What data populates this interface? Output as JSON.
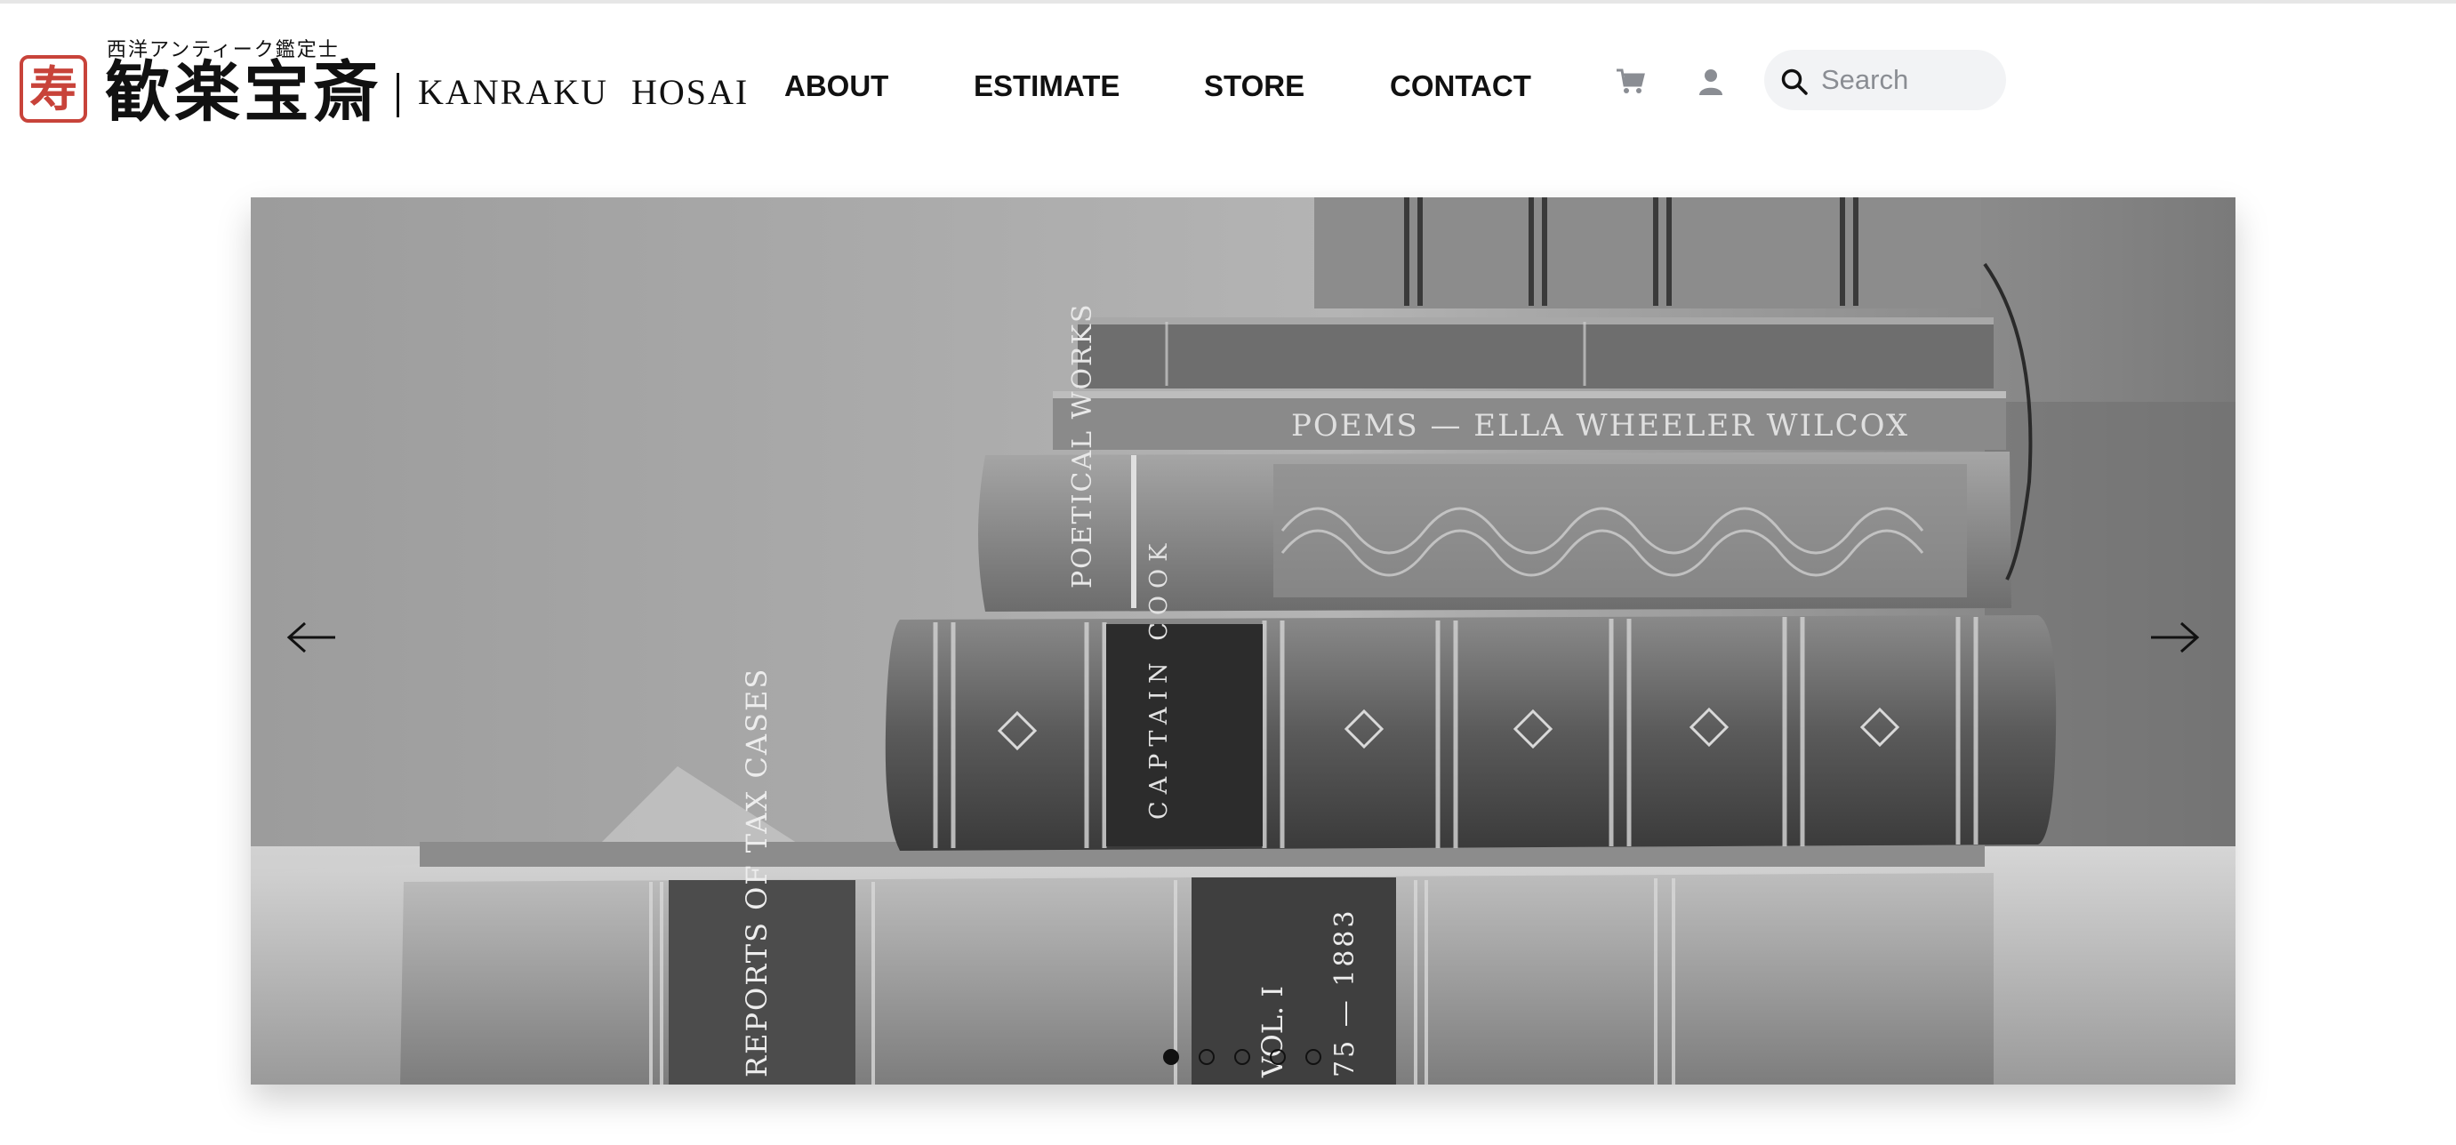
{
  "brand": {
    "seal_glyph": "寿",
    "subtitle": "西洋アンティーク鑑定士",
    "name_kanji": "歓楽宝斎",
    "name_en": "KANRAKU HOSAI",
    "seal_color": "#c8433a"
  },
  "nav": {
    "items": [
      {
        "label": "ABOUT"
      },
      {
        "label": "ESTIMATE"
      },
      {
        "label": "STORE"
      },
      {
        "label": "CONTACT"
      }
    ]
  },
  "header_icons": {
    "cart": "cart-icon",
    "account": "user-icon"
  },
  "search": {
    "placeholder": "Search",
    "value": ""
  },
  "hero": {
    "spine_texts": [
      "CAPTAIN COOK",
      "POETICAL WORKS",
      "POEMS — ELLA WHEELER WILCOX",
      "REPORTS OF TAX CASES",
      "VOL. I",
      "75 — 1883"
    ],
    "slide_count": 5,
    "active_slide": 1
  },
  "colors": {
    "text": "#111111",
    "search_bg": "#f2f3f5",
    "topline": "#e6e6e6"
  }
}
